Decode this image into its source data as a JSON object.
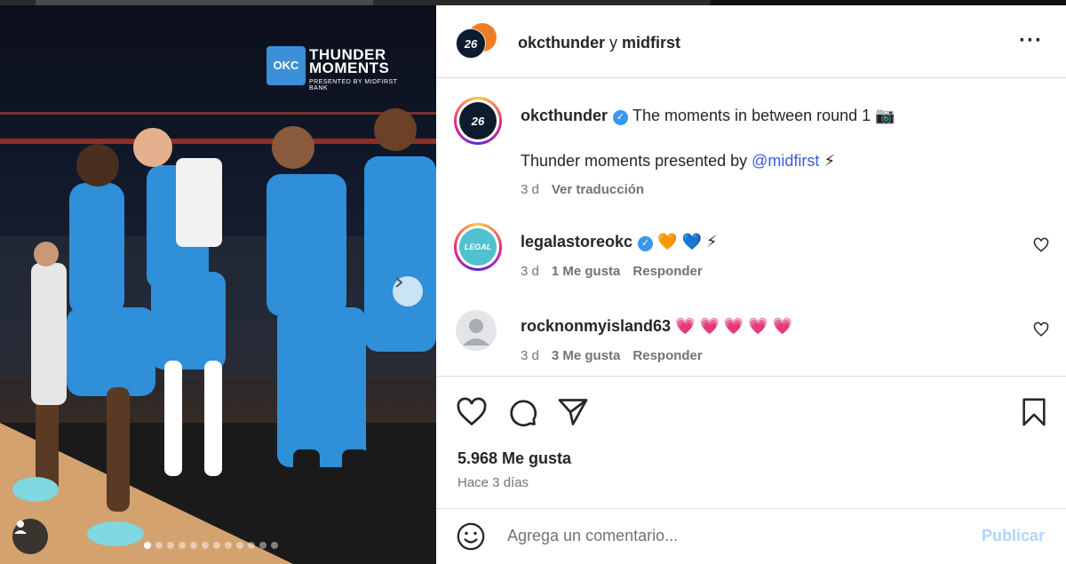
{
  "brand_overlay": {
    "logo_text": "OKC",
    "title_line1": "THUNDER",
    "title_line2": "MOMENTS",
    "presented_by": "PRESENTED BY MIDFIRST BANK"
  },
  "carousel": {
    "total_slides": 12,
    "active_slide": 1
  },
  "header": {
    "avatar_text": "26",
    "account_primary": "okcthunder",
    "connector": " y ",
    "account_secondary": "midfirst"
  },
  "caption": {
    "avatar_text": "26",
    "username": "okcthunder",
    "verified_glyph": "✓",
    "text": "The moments in between round 1",
    "text_emoji": "📷",
    "line2_prefix": "Thunder moments presented by ",
    "mention": "@midfirst",
    "line2_emoji": "⚡",
    "age": "3 d",
    "translate": "Ver traducción"
  },
  "comments": [
    {
      "avatar_text": "LEGAL",
      "username": "legalastoreokc",
      "verified_glyph": "✓",
      "text": "🧡 💙 ⚡",
      "age": "3 d",
      "likes": "1 Me gusta",
      "reply": "Responder"
    },
    {
      "username": "rocknonmyisland63",
      "text": "💗 💗 💗 💗 💗",
      "age": "3 d",
      "likes": "3 Me gusta",
      "reply": "Responder"
    }
  ],
  "stats": {
    "likes": "5.968 Me gusta",
    "posted": "Hace 3 días"
  },
  "composer": {
    "placeholder": "Agrega un comentario...",
    "publish": "Publicar"
  },
  "colors": {
    "accent": "#3897f0",
    "publish_disabled": "#b3d4f8",
    "okc_blue": "#2f8fd8",
    "okc_orange": "#f07d22"
  }
}
